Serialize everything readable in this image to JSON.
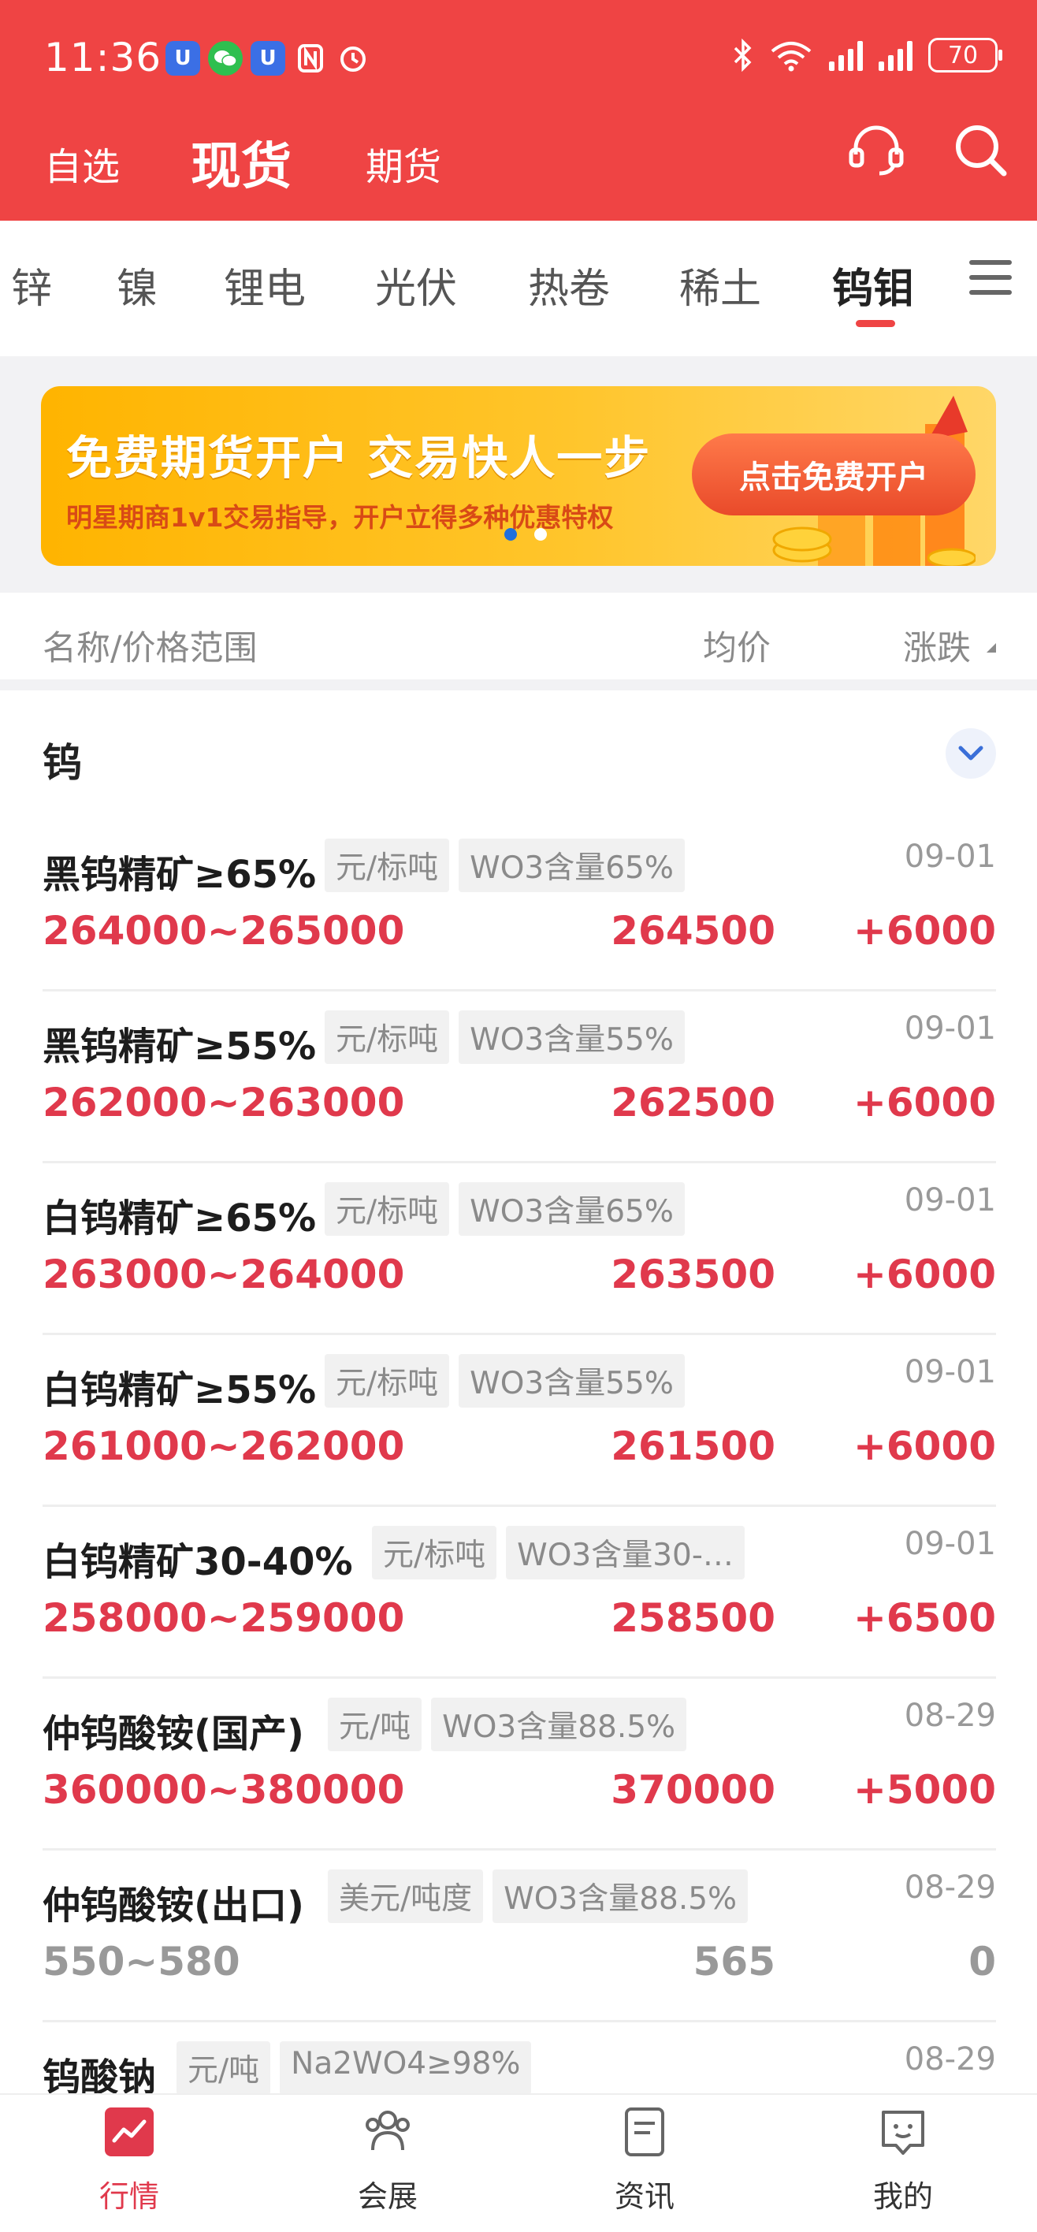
{
  "status_bar": {
    "time": "11:36",
    "battery": "70"
  },
  "header": {
    "tabs": [
      {
        "label": "自选"
      },
      {
        "label": "现货"
      },
      {
        "label": "期货"
      }
    ],
    "active_tab": "现货"
  },
  "categories": [
    {
      "label": "锌"
    },
    {
      "label": "镍"
    },
    {
      "label": "锂电"
    },
    {
      "label": "光伏"
    },
    {
      "label": "热卷"
    },
    {
      "label": "稀土"
    },
    {
      "label": "钨钼"
    }
  ],
  "active_category": "钨钼",
  "banner": {
    "title": "免费期货开户  交易快人一步",
    "subtitle": "明星期商1v1交易指导，开户立得多种优惠特权",
    "button": "点击免费开户"
  },
  "columns": {
    "name": "名称/价格范围",
    "avg": "均价",
    "change": "涨跌"
  },
  "group": {
    "title": "钨"
  },
  "rows": [
    {
      "name": "黑钨精矿≥65%",
      "unit": "元/标吨",
      "spec": "WO3含量65%",
      "date": "09-01",
      "range": "264000~265000",
      "avg": "264500",
      "change": "+6000",
      "trend": "up"
    },
    {
      "name": "黑钨精矿≥55%",
      "unit": "元/标吨",
      "spec": "WO3含量55%",
      "date": "09-01",
      "range": "262000~263000",
      "avg": "262500",
      "change": "+6000",
      "trend": "up"
    },
    {
      "name": "白钨精矿≥65%",
      "unit": "元/标吨",
      "spec": "WO3含量65%",
      "date": "09-01",
      "range": "263000~264000",
      "avg": "263500",
      "change": "+6000",
      "trend": "up"
    },
    {
      "name": "白钨精矿≥55%",
      "unit": "元/标吨",
      "spec": "WO3含量55%",
      "date": "09-01",
      "range": "261000~262000",
      "avg": "261500",
      "change": "+6000",
      "trend": "up"
    },
    {
      "name": "白钨精矿30-40%",
      "unit": "元/标吨",
      "spec": "WO3含量30-…",
      "date": "09-01",
      "range": "258000~259000",
      "avg": "258500",
      "change": "+6500",
      "trend": "up"
    },
    {
      "name": "仲钨酸铵(国产)",
      "unit": "元/吨",
      "spec": "WO3含量88.5%",
      "date": "08-29",
      "range": "360000~380000",
      "avg": "370000",
      "change": "+5000",
      "trend": "up"
    },
    {
      "name": "仲钨酸铵(出口)",
      "unit": "美元/吨度",
      "spec": "WO3含量88.5%",
      "date": "08-29",
      "range": "550~580",
      "avg": "565",
      "change": "0",
      "trend": "flat"
    },
    {
      "name": "钨酸钠",
      "unit": "元/吨",
      "spec": "Na2WO4≥98%",
      "date": "08-29",
      "range": "",
      "avg": "",
      "change": "",
      "trend": "up"
    }
  ],
  "bottom_nav": [
    {
      "label": "行情",
      "icon": "chart-icon"
    },
    {
      "label": "会展",
      "icon": "people-icon"
    },
    {
      "label": "资讯",
      "icon": "news-icon"
    },
    {
      "label": "我的",
      "icon": "profile-icon"
    }
  ],
  "colors": {
    "brand_red": "#ef4444",
    "up_red": "#e0394c",
    "flat_gray": "#999999"
  }
}
